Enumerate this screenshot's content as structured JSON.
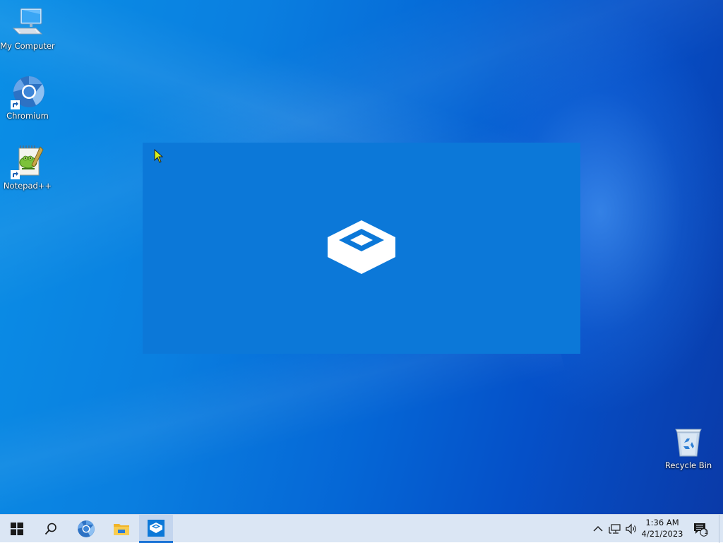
{
  "desktop": {
    "icons": [
      {
        "label": "My Computer",
        "icon": "computer-icon"
      },
      {
        "label": "Chromium",
        "icon": "chromium-icon"
      },
      {
        "label": "Notepad++",
        "icon": "notepadpp-icon"
      },
      {
        "label": "Recycle Bin",
        "icon": "recycle-bin-icon"
      }
    ]
  },
  "splash": {
    "icon": "sandbox-box-icon",
    "background": "#0c78d8"
  },
  "taskbar": {
    "buttons": [
      {
        "name": "start-button",
        "icon": "windows-logo-icon"
      },
      {
        "name": "search-button",
        "icon": "search-icon"
      },
      {
        "name": "chromium-taskbar",
        "icon": "chromium-icon"
      },
      {
        "name": "file-explorer-taskbar",
        "icon": "folder-icon"
      },
      {
        "name": "sandbox-taskbar",
        "icon": "sandbox-box-icon",
        "active": true
      }
    ],
    "tray": {
      "icons": [
        "chevron-up-icon",
        "network-icon",
        "volume-icon"
      ],
      "time": "1:36 AM",
      "date": "4/21/2023",
      "notification_count": "1"
    }
  },
  "colors": {
    "taskbar_bg": "#dbe6f4",
    "active_indicator": "#1a73d6",
    "accent": "#0078d7"
  }
}
